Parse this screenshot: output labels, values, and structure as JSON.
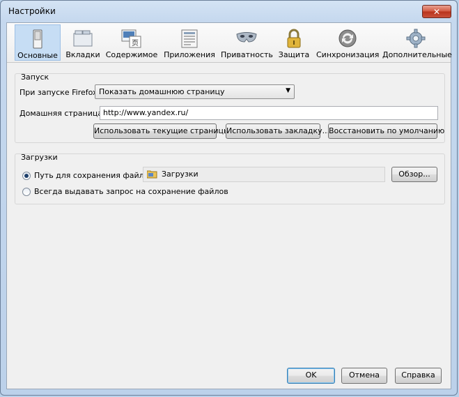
{
  "window": {
    "title": "Настройки",
    "close_label": "✕"
  },
  "tabs": [
    {
      "label": "Основные",
      "icon": "general-switch-icon"
    },
    {
      "label": "Вкладки",
      "icon": "tabs-icon"
    },
    {
      "label": "Содержимое",
      "icon": "content-icon"
    },
    {
      "label": "Приложения",
      "icon": "applications-icon"
    },
    {
      "label": "Приватность",
      "icon": "privacy-mask-icon"
    },
    {
      "label": "Защита",
      "icon": "security-lock-icon"
    },
    {
      "label": "Синхронизация",
      "icon": "sync-icon"
    },
    {
      "label": "Дополнительные",
      "icon": "advanced-gear-icon"
    }
  ],
  "startup": {
    "title": "Запуск",
    "on_start_label": "При запуске Firefox:",
    "on_start_value": "Показать домашнюю страницу",
    "homepage_label": "Домашняя страница:",
    "homepage_value": "http://www.yandex.ru/",
    "use_current_button": "Использовать текущие страницы",
    "use_bookmark_button": "Использовать закладку...",
    "restore_default_button": "Восстановить по умолчанию"
  },
  "downloads": {
    "title": "Загрузки",
    "save_to_label": "Путь для сохранения файлов",
    "save_to_value": "Загрузки",
    "browse_button": "Обзор...",
    "always_ask_label": "Всегда выдавать запрос на сохранение файлов"
  },
  "footer": {
    "ok": "OK",
    "cancel": "Отмена",
    "help": "Справка"
  }
}
